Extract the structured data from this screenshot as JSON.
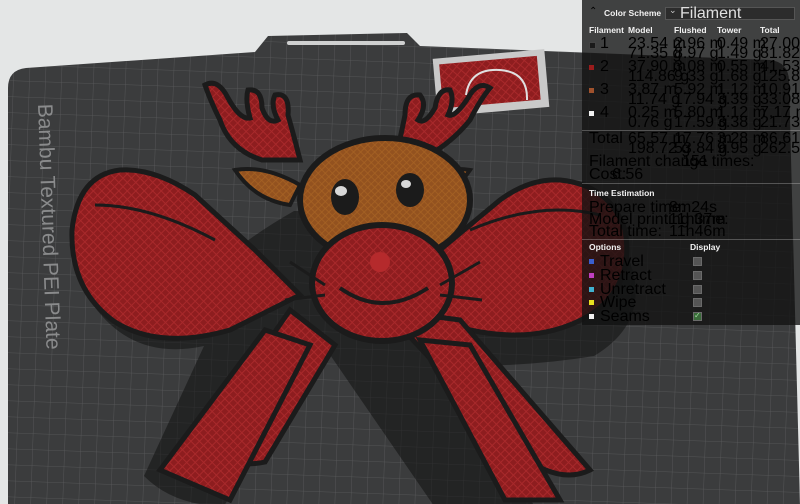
{
  "bed": {
    "label": "Bambu Textured PEI Plate"
  },
  "panel": {
    "title": "Color Scheme",
    "scheme_value": "Filament",
    "columns": [
      "Filament",
      "Model",
      "Flushed",
      "Tower",
      "Total"
    ],
    "filaments": [
      {
        "id": "1",
        "color": "#1a1a1a",
        "model_m": "23.54 m",
        "model_g": "71.35 g",
        "flushed_m": "2.96 m",
        "flushed_g": "8.97 g",
        "tower_m": "0.49 m",
        "tower_g": "1.49 g",
        "total_m": "27.00 m",
        "total_g": "81.82 g"
      },
      {
        "id": "2",
        "color": "#9b1c1c",
        "model_m": "37.90 m",
        "model_g": "114.86 g",
        "flushed_m": "3.08 m",
        "flushed_g": "9.33 g",
        "tower_m": "0.55 m",
        "tower_g": "1.68 g",
        "total_m": "41.53 m",
        "total_g": "125.87 g"
      },
      {
        "id": "3",
        "color": "#a0522d",
        "model_m": "3.87 m",
        "model_g": "11.74 g",
        "flushed_m": "5.92 m",
        "flushed_g": "17.94 g",
        "tower_m": "1.12 m",
        "tower_g": "3.39 g",
        "total_m": "10.91 m",
        "total_g": "33.08 g"
      },
      {
        "id": "4",
        "color": "#f2f2f2",
        "model_m": "0.25 m",
        "model_g": "0.76 g",
        "flushed_m": "5.80 m",
        "flushed_g": "17.59 g",
        "tower_m": "1.12 m",
        "tower_g": "3.38 g",
        "total_m": "7.17 m",
        "total_g": "21.73 g"
      }
    ],
    "total": {
      "label": "Total",
      "model_m": "65.57 m",
      "model_g": "198.72 g",
      "flushed_m": "17.76 m",
      "flushed_g": "53.84 g",
      "tower_m": "3.28 m",
      "tower_g": "9.95 g",
      "total_m": "86.61 m",
      "total_g": "262.50 g"
    },
    "filament_changes": {
      "label": "Filament change times:",
      "value": "151"
    },
    "cost": {
      "label": "Cost:",
      "value": "6.56"
    },
    "time_estimation": {
      "title": "Time Estimation",
      "prepare": {
        "label": "Prepare time:",
        "value": "8m24s"
      },
      "model": {
        "label": "Model printing time:",
        "value": "11h37m"
      },
      "total": {
        "label": "Total time:",
        "value": "11h46m"
      }
    },
    "options": {
      "title": "Options",
      "display_label": "Display",
      "items": [
        {
          "label": "Travel",
          "color": "#3a5fcd",
          "checked": false
        },
        {
          "label": "Retract",
          "color": "#c040c0",
          "checked": false
        },
        {
          "label": "Unretract",
          "color": "#40b0d0",
          "checked": false
        },
        {
          "label": "Wipe",
          "color": "#e8e020",
          "checked": false
        },
        {
          "label": "Seams",
          "color": "#f0f0f0",
          "checked": true
        }
      ]
    }
  }
}
